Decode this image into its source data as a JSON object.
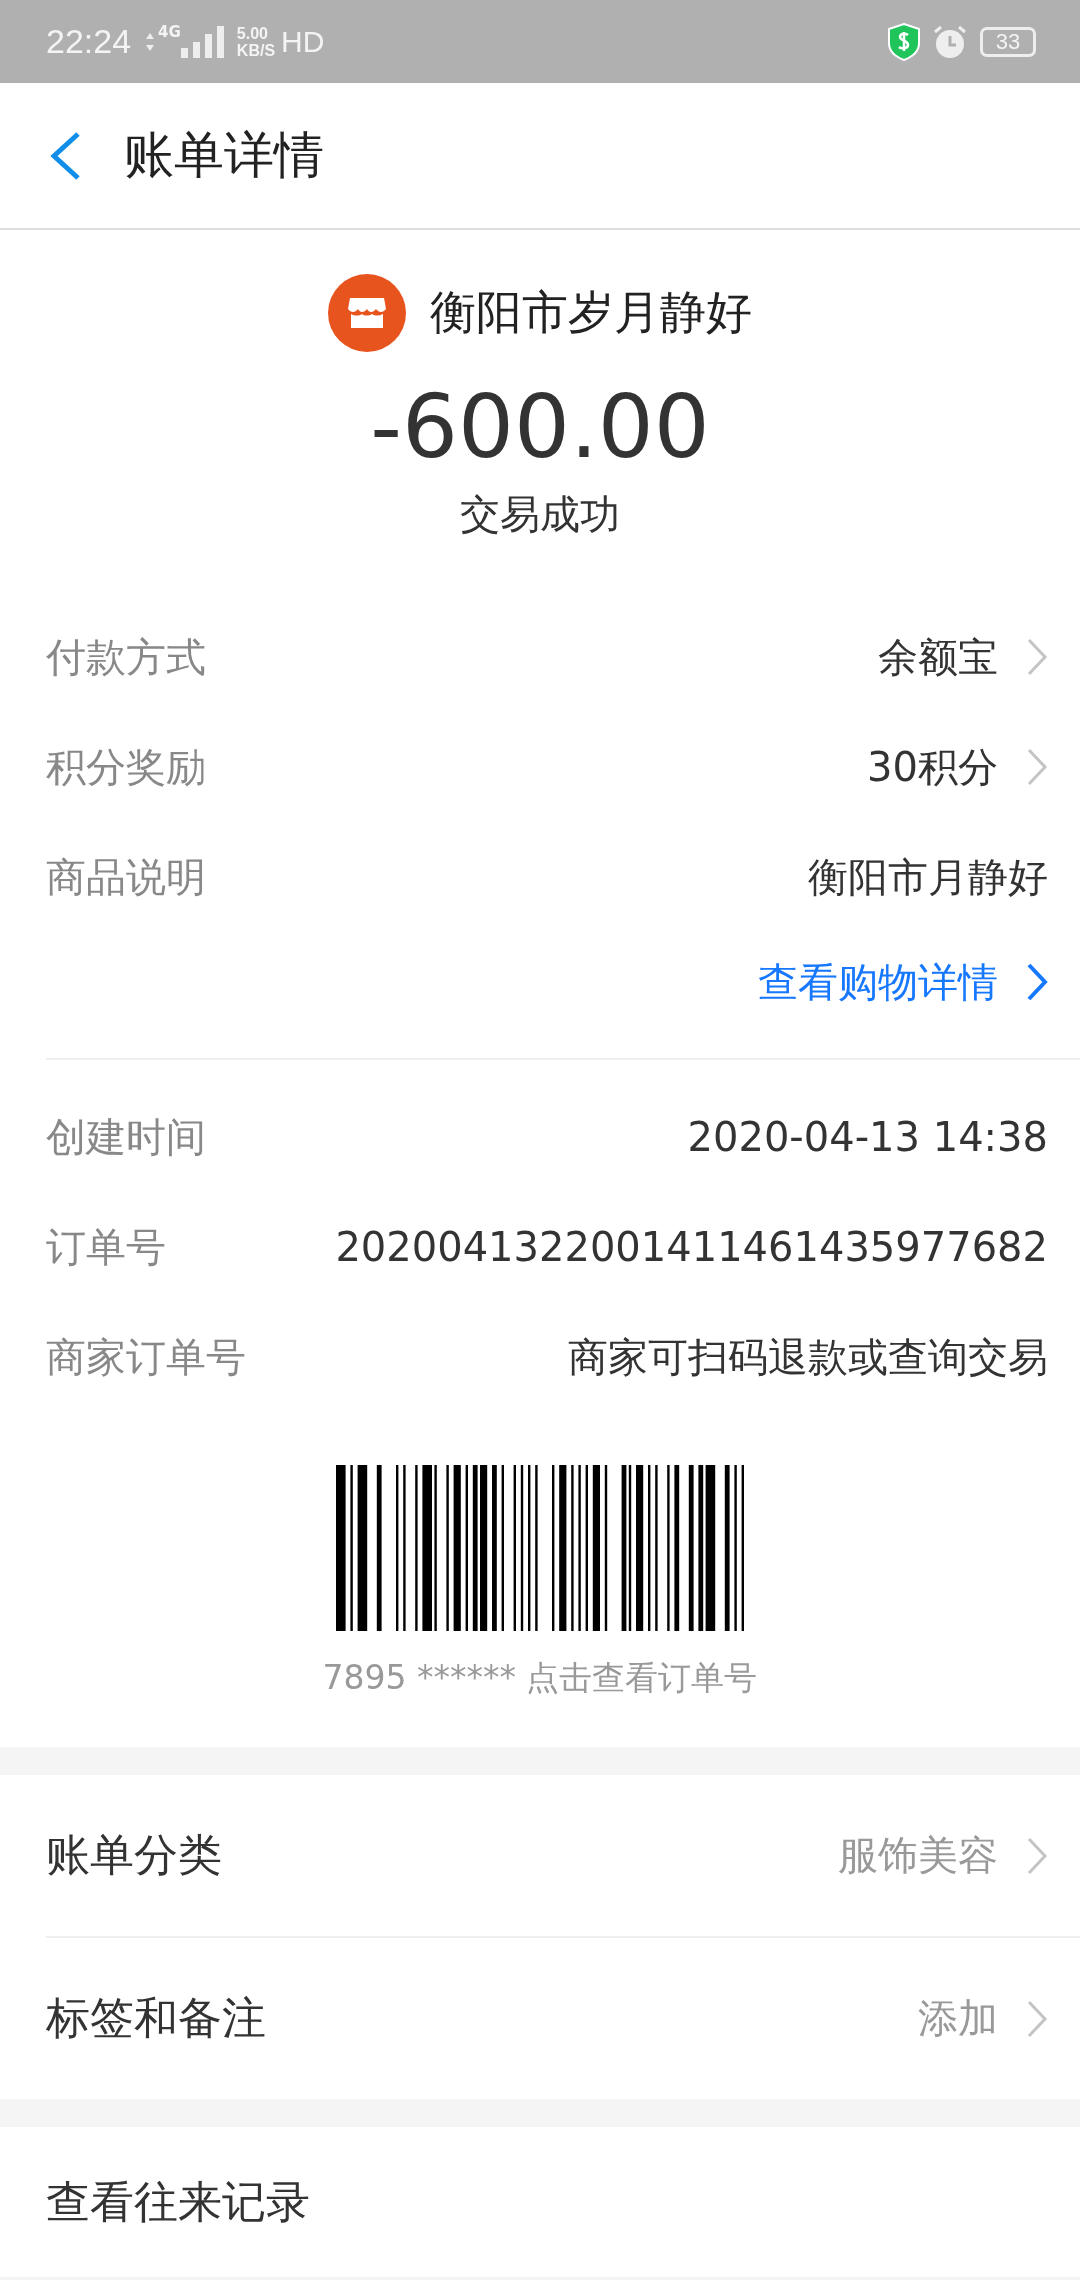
{
  "status_bar": {
    "time": "22:24",
    "network": "4G",
    "speed": "5.00",
    "speed_unit": "KB/S",
    "hd": "HD",
    "battery": "33"
  },
  "header": {
    "title": "账单详情"
  },
  "summary": {
    "merchant": "衡阳市岁月静好",
    "amount": "-600.00",
    "status": "交易成功"
  },
  "details": [
    {
      "kind": "row",
      "label": "付款方式",
      "value": "余额宝",
      "chevron": true
    },
    {
      "kind": "row",
      "label": "积分奖励",
      "value": "30积分",
      "chevron": true
    },
    {
      "kind": "row",
      "label": "商品说明",
      "value": "衡阳市月静好",
      "chevron": false
    },
    {
      "kind": "link",
      "value": "查看购物详情",
      "chevron": true
    }
  ],
  "order": [
    {
      "label": "创建时间",
      "value": "2020-04-13 14:38"
    },
    {
      "label": "订单号",
      "value": "2020041322001411461435977682"
    },
    {
      "label": "商家订单号",
      "value": "商家可扫码退款或查询交易"
    }
  ],
  "barcode": {
    "caption": "7895 ****** 点击查看订单号"
  },
  "settings": [
    {
      "label": "账单分类",
      "value": "服饰美容"
    },
    {
      "label": "标签和备注",
      "value": "添加"
    }
  ],
  "history": {
    "label": "查看往来记录"
  }
}
